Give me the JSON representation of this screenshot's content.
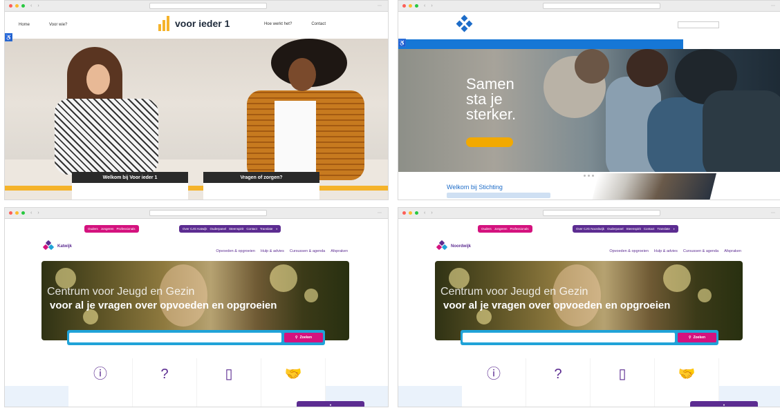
{
  "window1": {
    "nav_left": [
      "Home",
      "Voor wie?"
    ],
    "logo_text": "voor ieder 1",
    "nav_right": [
      "Hoe werkt het?",
      "Contact"
    ],
    "cards": [
      {
        "title": "Welkom bij Voor ieder 1"
      },
      {
        "title": "Vragen of zorgen?"
      }
    ],
    "colors": {
      "accent": "#f5b32a",
      "dark": "#2a2a2a"
    }
  },
  "window2": {
    "hero_line1": "Samen",
    "hero_line2": "sta je",
    "hero_line3": "sterker.",
    "welcome": "Welkom bij Stichting",
    "colors": {
      "nav": "#1677d6",
      "button": "#f2a900"
    }
  },
  "window3": {
    "top_pink": [
      "Ouders",
      "Jongeren",
      "Professionals"
    ],
    "top_purple": [
      "Over CJG Katwijk",
      "Ouderpanel",
      "Steenspirit",
      "Contact",
      "Translate"
    ],
    "city": "Katwijk",
    "nav": [
      "Opvoeden & opgroeien",
      "Hulp & advies",
      "Cursussen & agenda",
      "Afspraken"
    ],
    "banner_title1": "Centrum voor Jeugd en Gezin",
    "banner_title2": "voor al je vragen over opvoeden en opgroeien",
    "search_button": "Zoeken",
    "tiles": [
      {
        "icon": "info-icon",
        "glyph": "ⓘ"
      },
      {
        "icon": "question-bubble-icon",
        "glyph": "?"
      },
      {
        "icon": "notebook-icon",
        "glyph": "▯"
      },
      {
        "icon": "handshake-icon",
        "glyph": "🤝"
      }
    ]
  },
  "window4": {
    "top_pink": [
      "Ouders",
      "Jongeren",
      "Professionals"
    ],
    "top_purple": [
      "Over CJG Noordwijk",
      "Ouderpanel",
      "Steenspirit",
      "Contact",
      "Translate"
    ],
    "city": "Noordwijk",
    "nav": [
      "Opvoeden & opgroeien",
      "Hulp & advies",
      "Cursussen & agenda",
      "Afspraken"
    ],
    "banner_title1": "Centrum voor Jeugd en Gezin",
    "banner_title2": "voor al je vragen over opvoeden en opgroeien",
    "search_button": "Zoeken",
    "tiles": [
      {
        "icon": "info-icon",
        "glyph": "ⓘ"
      },
      {
        "icon": "question-bubble-icon",
        "glyph": "?"
      },
      {
        "icon": "notebook-icon",
        "glyph": "▯"
      },
      {
        "icon": "handshake-icon",
        "glyph": "🤝"
      }
    ]
  },
  "cjg_colors": {
    "pink": "#d4127e",
    "purple": "#5c2c91",
    "search": "#20a3d8"
  }
}
